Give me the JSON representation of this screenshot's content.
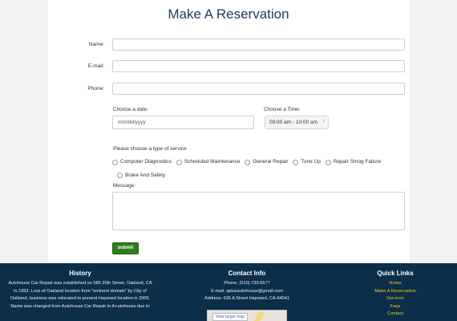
{
  "page": {
    "title": "Make A Reservation"
  },
  "form": {
    "name_label": "Name:",
    "email_label": "E-mail:",
    "phone_label": "Phone:",
    "date_label": "Choose a date:",
    "date_placeholder": "mm/dd/yyyy",
    "time_label": "Choose a Time:",
    "time_selected": "09:00 am - 10:00 am",
    "service_label": "Please choose a type of service",
    "services": [
      "Computer Diagnostics",
      "Scheduled Maintenance",
      "General Repair",
      "Tune Up",
      "Repair Smog Failure",
      "Brake And Safety"
    ],
    "message_label": "Message:",
    "submit_label": "submit"
  },
  "footer": {
    "history_title": "History",
    "history_text": "Autohouse Car Repair was established on 585 20th Street, Oakland, CA in 1993. Loss of Oakland location from \"eminent domain\" by City of Oakland, business was relocated to present Hayward location in 2005. Name was changed from Autohouse Car Repair to A+utohouse due to",
    "contact_title": "Contact Info",
    "phone": "Phone: (510) 733-5577",
    "email": "E-mail: aplusautohouse@gmail.com",
    "address": "Address: 636 A Street Hayward, CA-94541",
    "map_button": "View larger map",
    "links_title": "Quick Links",
    "links": [
      "Home",
      "Make A Reservation",
      "Services",
      "Faqs",
      "Contact"
    ]
  },
  "colors": {
    "title": "#1d3a5c",
    "footer_bg": "#0b2e4a",
    "submit_bg": "#2e7d1e",
    "link": "#f0c419"
  }
}
